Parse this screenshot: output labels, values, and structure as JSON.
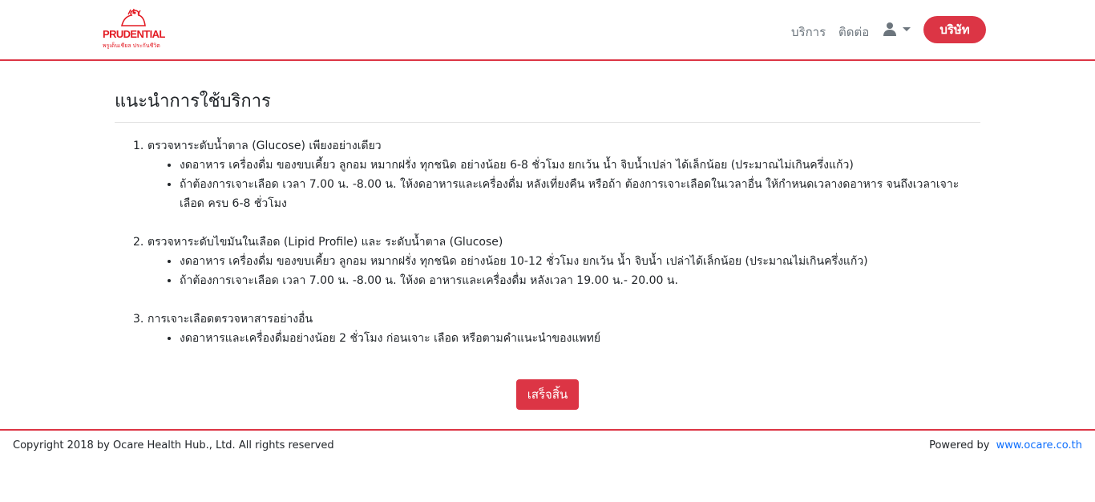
{
  "brand": {
    "name": "PRUDENTIAL",
    "tagline": "พรูเด็นเชียล ประกันชีวิต",
    "color": "#e31b23"
  },
  "nav": {
    "services": "บริการ",
    "contact": "ติดต่อ",
    "user_icon": "user-icon",
    "caret_icon": "caret-down-icon",
    "company_button": "บริษัท",
    "accent": "#dc3545"
  },
  "main": {
    "title": "แนะนำการใช้บริการ",
    "sections": [
      {
        "number": "1.",
        "heading": "ตรวจหาระดับน้ำตาล (Glucose) เพียงอย่างเดียว",
        "items": [
          "งดอาหาร เครื่องดื่ม ของขบเคี้ยว ลูกอม หมากฝรั่ง ทุกชนิด อย่างน้อย 6-8 ชั่วโมง ยกเว้น น้ำ จิบน้ำเปล่า ได้เล็กน้อย (ประมาณไม่เกินครึ่งแก้ว)",
          "ถ้าต้องการเจาะเลือด เวลา 7.00 น. -8.00 น. ให้งดอาหารและเครื่องดื่ม หลังเที่ยงคืน หรือถ้า ต้องการเจาะเลือดในเวลาอื่น ให้กำหนดเวลางดอาหาร จนถึงเวลาเจาะเลือด ครบ 6-8 ชั่วโมง"
        ]
      },
      {
        "number": "2.",
        "heading": "ตรวจหาระดับไขมันในเลือด (Lipid Profile) และ ระดับน้ำตาล (Glucose)",
        "items": [
          "งดอาหาร เครื่องดื่ม ของขบเคี้ยว ลูกอม หมากฝรั่ง ทุกชนิด อย่างน้อย 10-12 ชั่วโมง ยกเว้น น้ำ จิบน้ำ เปล่าได้เล็กน้อย (ประมาณไม่เกินครึ่งแก้ว)",
          "ถ้าต้องการเจาะเลือด เวลา 7.00 น. -8.00 น. ให้งด อาหารและเครื่องดื่ม หลังเวลา 19.00 น.- 20.00 น."
        ]
      },
      {
        "number": "3.",
        "heading": "การเจาะเลือดตรวจหาสารอย่างอื่น",
        "items": [
          "งดอาหารและเครื่องดื่มอย่างน้อย 2 ชั่วโมง ก่อนเจาะ เลือด หรือตามคำแนะนำของแพทย์"
        ]
      }
    ],
    "finish_button": "เสร็จสิ้น"
  },
  "footer": {
    "copyright": "Copyright 2018 by Ocare Health Hub., Ltd. All rights reserved",
    "powered_by": "Powered by",
    "link_text": "www.ocare.co.th",
    "link_color": "#0d6efd"
  }
}
